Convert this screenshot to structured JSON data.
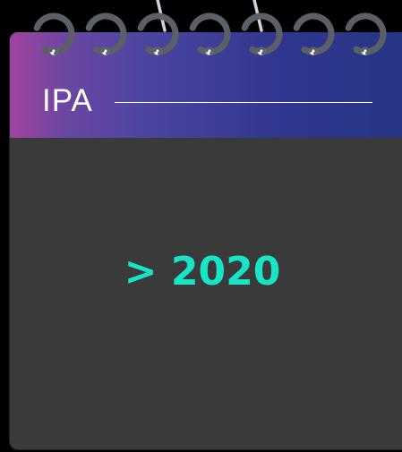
{
  "calendar": {
    "title": "IPA",
    "value": "> 2020"
  },
  "colors": {
    "header_gradient": [
      "#a2449e",
      "#4b45a0",
      "#263683"
    ],
    "body_background": "#3a3a3a",
    "value_text": "#18e4c7",
    "title_text": "#ffffff",
    "ring": "#5c6066"
  },
  "icons": {
    "binding": "spiral-rings-icon",
    "hanger": "hanging-wire-icon"
  }
}
